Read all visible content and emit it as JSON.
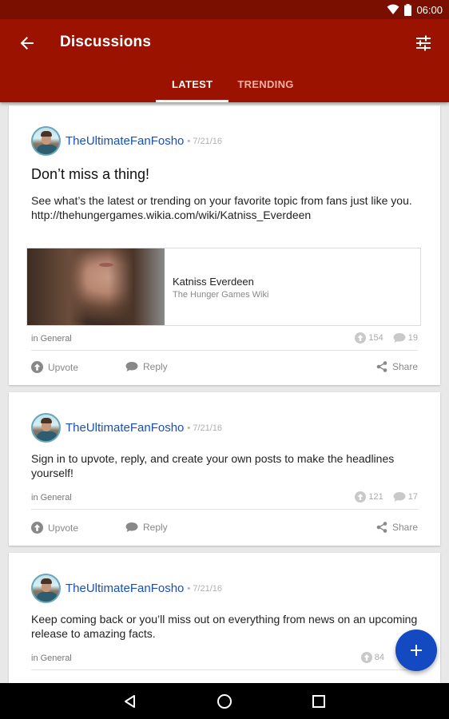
{
  "status_bar": {
    "time": "06:00",
    "icons": [
      "wifi-icon",
      "battery-icon"
    ]
  },
  "header": {
    "title": "Discussions",
    "back_icon": "arrow-back-icon",
    "filter_icon": "tune-sliders-icon",
    "tabs": [
      {
        "label": "LATEST",
        "active": true
      },
      {
        "label": "TRENDING",
        "active": false
      }
    ],
    "colors": {
      "bar": "#9c1200",
      "status": "#7a0f00"
    }
  },
  "posts": [
    {
      "author": "TheUltimateFanFosho",
      "date": "• 7/21/16",
      "title": "Don’t miss a thing!",
      "body": "See what’s the latest or trending on your favorite topic from fans just like you.",
      "link": "http://thehungergames.wikia.com/wiki/Katniss_Everdeen",
      "preview": {
        "title": "Katniss Everdeen",
        "subtitle": "The Hunger Games Wiki"
      },
      "category": "in General",
      "upvotes": "154",
      "replies": "19",
      "actions": {
        "upvote": "Upvote",
        "reply": "Reply",
        "share": "Share"
      }
    },
    {
      "author": "TheUltimateFanFosho",
      "date": "• 7/21/16",
      "body": "Sign in to upvote, reply, and create your own posts to make the headlines yourself!",
      "category": "in General",
      "upvotes": "121",
      "replies": "17",
      "actions": {
        "upvote": "Upvote",
        "reply": "Reply",
        "share": "Share"
      }
    },
    {
      "author": "TheUltimateFanFosho",
      "date": "• 7/21/16",
      "body": "Keep coming back or you’ll miss out on everything from news on an upcoming release to amazing facts.",
      "category": "in General",
      "upvotes": "84"
    }
  ],
  "fab": {
    "icon": "plus-icon",
    "color": "#1349c1"
  },
  "nav_bar": {
    "icons": [
      "back-triangle-icon",
      "home-circle-icon",
      "recents-square-icon"
    ]
  }
}
